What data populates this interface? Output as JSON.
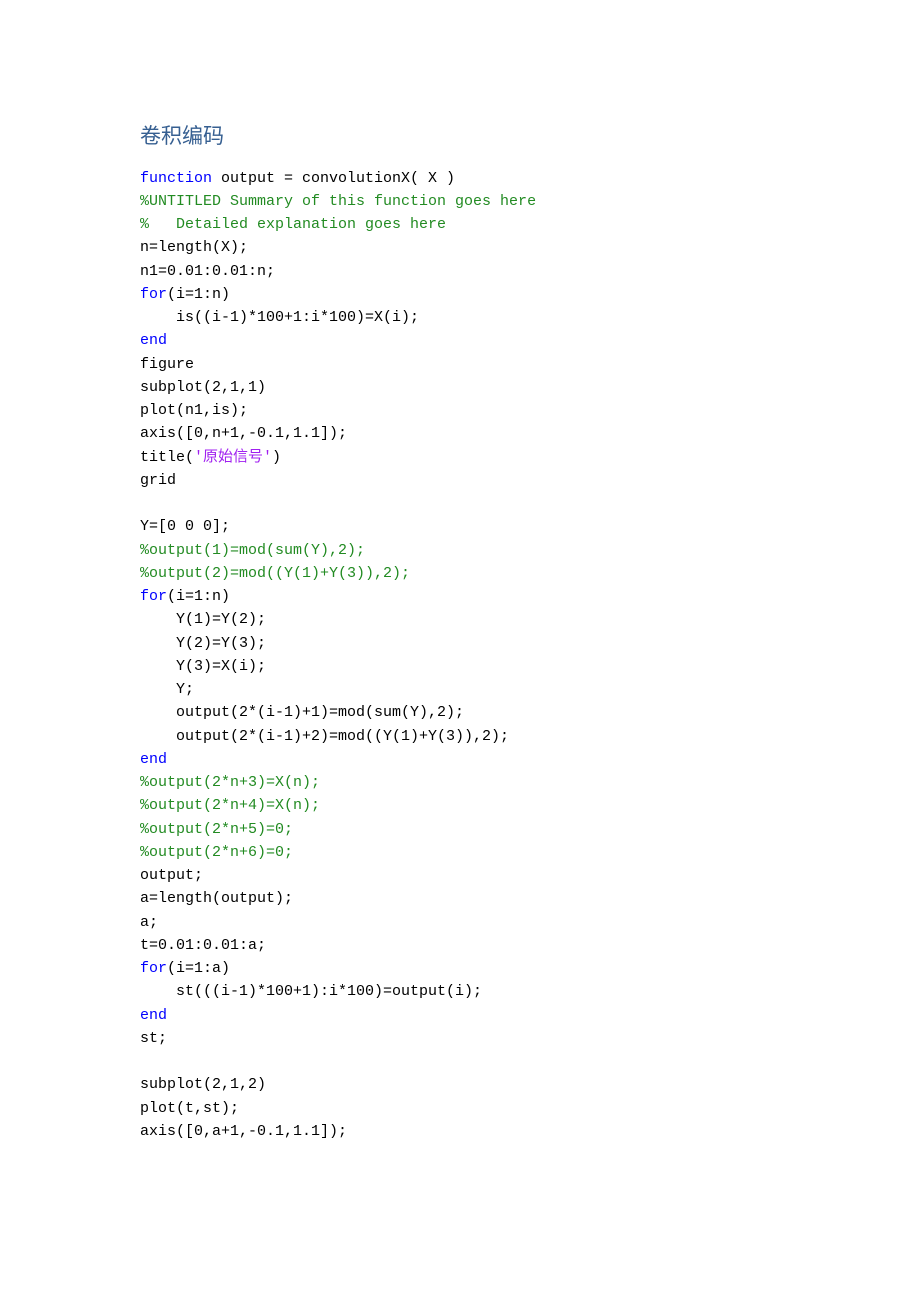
{
  "heading": "卷积编码",
  "code": [
    [
      [
        "kw",
        "function "
      ],
      [
        "plain",
        "output = convolutionX( X )"
      ]
    ],
    [
      [
        "comment",
        "%UNTITLED Summary of this function goes here"
      ]
    ],
    [
      [
        "comment",
        "%   Detailed explanation goes here"
      ]
    ],
    [
      [
        "plain",
        "n=length(X);"
      ]
    ],
    [
      [
        "plain",
        "n1=0.01:0.01:n;"
      ]
    ],
    [
      [
        "kw",
        "for"
      ],
      [
        "plain",
        "(i=1:n)"
      ]
    ],
    [
      [
        "plain",
        "    is((i-1)*100+1:i*100)=X(i);"
      ]
    ],
    [
      [
        "kw",
        "end"
      ]
    ],
    [
      [
        "plain",
        "figure"
      ]
    ],
    [
      [
        "plain",
        "subplot(2,1,1)"
      ]
    ],
    [
      [
        "plain",
        "plot(n1,is);"
      ]
    ],
    [
      [
        "plain",
        "axis([0,n+1,-0.1,1.1]);"
      ]
    ],
    [
      [
        "plain",
        "title("
      ],
      [
        "str",
        "'原始信号'"
      ],
      [
        "plain",
        ")"
      ]
    ],
    [
      [
        "plain",
        "grid"
      ]
    ],
    [
      [
        "plain",
        ""
      ]
    ],
    [
      [
        "plain",
        "Y=[0 0 0];"
      ]
    ],
    [
      [
        "comment",
        "%output(1)=mod(sum(Y),2);"
      ]
    ],
    [
      [
        "comment",
        "%output(2)=mod((Y(1)+Y(3)),2);"
      ]
    ],
    [
      [
        "kw",
        "for"
      ],
      [
        "plain",
        "(i=1:n)"
      ]
    ],
    [
      [
        "plain",
        "    Y(1)=Y(2);"
      ]
    ],
    [
      [
        "plain",
        "    Y(2)=Y(3);"
      ]
    ],
    [
      [
        "plain",
        "    Y(3)=X(i);"
      ]
    ],
    [
      [
        "plain",
        "    Y;"
      ]
    ],
    [
      [
        "plain",
        "    output(2*(i-1)+1)=mod(sum(Y),2);"
      ]
    ],
    [
      [
        "plain",
        "    output(2*(i-1)+2)=mod((Y(1)+Y(3)),2);"
      ]
    ],
    [
      [
        "kw",
        "end"
      ]
    ],
    [
      [
        "comment",
        "%output(2*n+3)=X(n);"
      ]
    ],
    [
      [
        "comment",
        "%output(2*n+4)=X(n);"
      ]
    ],
    [
      [
        "comment",
        "%output(2*n+5)=0;"
      ]
    ],
    [
      [
        "comment",
        "%output(2*n+6)=0;"
      ]
    ],
    [
      [
        "plain",
        "output;"
      ]
    ],
    [
      [
        "plain",
        "a=length(output);"
      ]
    ],
    [
      [
        "plain",
        "a;"
      ]
    ],
    [
      [
        "plain",
        "t=0.01:0.01:a;"
      ]
    ],
    [
      [
        "kw",
        "for"
      ],
      [
        "plain",
        "(i=1:a)"
      ]
    ],
    [
      [
        "plain",
        "    st(((i-1)*100+1):i*100)=output(i);"
      ]
    ],
    [
      [
        "kw",
        "end"
      ]
    ],
    [
      [
        "plain",
        "st;"
      ]
    ],
    [
      [
        "plain",
        ""
      ]
    ],
    [
      [
        "plain",
        "subplot(2,1,2)"
      ]
    ],
    [
      [
        "plain",
        "plot(t,st);"
      ]
    ],
    [
      [
        "plain",
        "axis([0,a+1,-0.1,1.1]);"
      ]
    ]
  ]
}
